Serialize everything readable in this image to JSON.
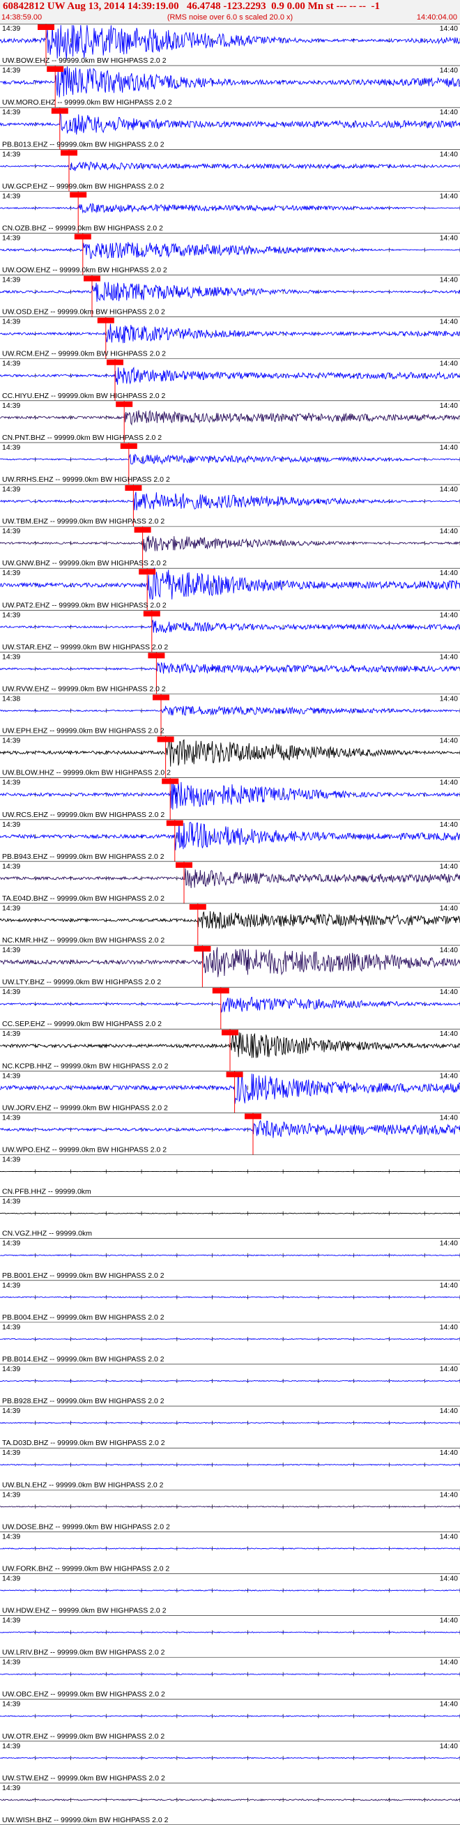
{
  "header": {
    "title": "60842812 UW Aug 13, 2014 14:39:19.00   46.4748 -123.2293  0.9 0.00 Mn st --- -- --  -1",
    "start_time": "14:38:59.00",
    "subtitle": "(RMS noise over 6.0 s scaled 20.0 x)",
    "end_time": "14:40:04.00"
  },
  "colors": {
    "blue": "#0000ff",
    "purple": "#2a0f5e",
    "black": "#000000",
    "pick": "#ff0000"
  },
  "chart_data": {
    "type": "line",
    "title": "60842812 UW Aug 13, 2014 14:39:19.00   46.4748 -123.2293  0.9 0.00 Mn st --- -- --  -1",
    "xlabel": "",
    "ylabel": "",
    "x_start": "14:38:59.00",
    "x_end": "14:40:04.00",
    "series": [
      {
        "name": "UW.BOW.EHZ -- 99999.0km BW  HIGHPASS  2.0  2",
        "tick_left": "14:39",
        "tick_right": "14:40",
        "color": "blue",
        "amp": 1.0,
        "clip": true,
        "pick": 0.1
      },
      {
        "name": "UW.MORO.EHZ -- 99999.0km BW  HIGHPASS  2.0  2",
        "tick_left": "14:39",
        "tick_right": "14:40",
        "color": "blue",
        "amp": 0.8,
        "pick": 0.12
      },
      {
        "name": "PB.B013.EHZ -- 99999.0km BW  HIGHPASS  2.0  2",
        "tick_left": "14:39",
        "tick_right": "14:40",
        "color": "blue",
        "amp": 0.6,
        "pick": 0.13
      },
      {
        "name": "UW.GCP.EHZ -- 99999.0km BW  HIGHPASS  2.0  2",
        "tick_left": "14:39",
        "tick_right": "14:40",
        "color": "blue",
        "amp": 0.3,
        "pick": 0.15
      },
      {
        "name": "CN.OZB.BHZ -- 99999.0km BW  HIGHPASS  2.0  2",
        "tick_left": "14:39",
        "tick_right": "14:40",
        "color": "blue",
        "amp": 0.3,
        "pick": 0.17
      },
      {
        "name": "UW.OOW.EHZ -- 99999.0km BW  HIGHPASS  2.0  2",
        "tick_left": "14:39",
        "tick_right": "14:40",
        "color": "blue",
        "amp": 0.5,
        "clip": true,
        "pick": 0.18
      },
      {
        "name": "UW.OSD.EHZ -- 99999.0km BW  HIGHPASS  2.0  2",
        "tick_left": "14:39",
        "tick_right": "14:40",
        "color": "blue",
        "amp": 0.5,
        "clip": true,
        "pick": 0.2
      },
      {
        "name": "UW.RCM.EHZ -- 99999.0km BW  HIGHPASS  2.0  2",
        "tick_left": "14:39",
        "tick_right": "14:40",
        "color": "blue",
        "amp": 0.5,
        "clip": true,
        "pick": 0.23
      },
      {
        "name": "CC.HIYU.EHZ -- 99999.0km BW  HIGHPASS  2.0  2",
        "tick_left": "14:39",
        "tick_right": "14:40",
        "color": "blue",
        "amp": 0.5,
        "pick": 0.25
      },
      {
        "name": "CN.PNT.BHZ -- 99999.0km BW  HIGHPASS  2.0  2",
        "tick_left": "14:39",
        "tick_right": "14:40",
        "color": "purple",
        "amp": 0.5,
        "pick": 0.27
      },
      {
        "name": "UW.RRHS.EHZ -- 99999.0km BW  HIGHPASS  2.0  2",
        "tick_left": "14:39",
        "tick_right": "14:40",
        "color": "blue",
        "amp": 0.3,
        "pick": 0.28
      },
      {
        "name": "UW.TBM.EHZ -- 99999.0km BW  HIGHPASS  2.0  2",
        "tick_left": "14:39",
        "tick_right": "14:40",
        "color": "blue",
        "amp": 0.5,
        "pick": 0.29
      },
      {
        "name": "UW.GNW.BHZ -- 99999.0km BW  HIGHPASS  2.0  2",
        "tick_left": "14:39",
        "tick_right": "14:40",
        "color": "purple",
        "amp": 0.4,
        "pick": 0.31
      },
      {
        "name": "UW.PAT2.EHZ -- 99999.0km BW  HIGHPASS  2.0  2",
        "tick_left": "14:39",
        "tick_right": "14:40",
        "color": "blue",
        "amp": 0.9,
        "pick": 0.32
      },
      {
        "name": "UW.STAR.EHZ -- 99999.0km BW  HIGHPASS  2.0  2",
        "tick_left": "14:39",
        "tick_right": "14:40",
        "color": "blue",
        "amp": 0.4,
        "pick": 0.33
      },
      {
        "name": "UW.RVW.EHZ -- 99999.0km BW  HIGHPASS  2.0  2",
        "tick_left": "14:39",
        "tick_right": "14:40",
        "color": "blue",
        "amp": 0.4,
        "pick": 0.34
      },
      {
        "name": "UW.EPH.EHZ -- 99999.0km BW  HIGHPASS  2.0  2",
        "tick_left": "14:38",
        "tick_right": "14:40",
        "color": "blue",
        "amp": 0.3,
        "pick": 0.35
      },
      {
        "name": "UW.BLOW.HHZ -- 99999.0km BW  HIGHPASS  2.0  2",
        "tick_left": "14:39",
        "tick_right": "14:40",
        "color": "black",
        "amp": 0.7,
        "pick": 0.36
      },
      {
        "name": "UW.RCS.EHZ -- 99999.0km BW  HIGHPASS  2.0  2",
        "tick_left": "14:39",
        "tick_right": "14:40",
        "color": "blue",
        "amp": 0.7,
        "pick": 0.37
      },
      {
        "name": "PB.B943.EHZ -- 99999.0km BW  HIGHPASS  2.0  2",
        "tick_left": "14:39",
        "tick_right": "14:40",
        "color": "blue",
        "amp": 0.8,
        "pick": 0.38
      },
      {
        "name": "TA.E04D.BHZ -- 99999.0km BW  HIGHPASS  2.0  2",
        "tick_left": "14:39",
        "tick_right": "14:40",
        "color": "purple",
        "amp": 0.6,
        "pick": 0.4
      },
      {
        "name": "NC.KMR.HHZ -- 99999.0km BW  HIGHPASS  2.0  2",
        "tick_left": "14:39",
        "tick_right": "14:40",
        "color": "black",
        "amp": 0.6,
        "pick": 0.43
      },
      {
        "name": "UW.LTY.BHZ -- 99999.0km BW  HIGHPASS  2.0  2",
        "tick_left": "14:39",
        "tick_right": "14:40",
        "color": "purple",
        "amp": 0.9,
        "pick": 0.44
      },
      {
        "name": "CC.SEP.EHZ -- 99999.0km BW  HIGHPASS  2.0  2",
        "tick_left": "14:39",
        "tick_right": "14:40",
        "color": "blue",
        "amp": 0.4,
        "pick": 0.48
      },
      {
        "name": "NC.KCPB.HHZ -- 99999.0km BW  HIGHPASS  2.0  2",
        "tick_left": "14:39",
        "tick_right": "14:40",
        "color": "black",
        "amp": 0.7,
        "pick": 0.5
      },
      {
        "name": "UW.JORV.EHZ -- 99999.0km BW  HIGHPASS  2.0  2",
        "tick_left": "14:39",
        "tick_right": "14:40",
        "color": "blue",
        "amp": 0.9,
        "pick": 0.51
      },
      {
        "name": "UW.WPO.EHZ -- 99999.0km BW  HIGHPASS  2.0  2",
        "tick_left": "14:39",
        "tick_right": "14:40",
        "color": "blue",
        "amp": 0.6,
        "pick": 0.55
      },
      {
        "name": "CN.PFB.HHZ -- 99999.0km",
        "tick_left": "14:39",
        "tick_right": "",
        "color": "black",
        "amp": 0.05
      },
      {
        "name": "CN.VGZ.HHZ -- 99999.0km",
        "tick_left": "14:39",
        "tick_right": "",
        "color": "black",
        "amp": 0.15
      },
      {
        "name": "PB.B001.EHZ -- 99999.0km BW  HIGHPASS  2.0  2",
        "tick_left": "14:39",
        "tick_right": "14:40",
        "color": "blue",
        "amp": 0.2
      },
      {
        "name": "PB.B004.EHZ -- 99999.0km BW  HIGHPASS  2.0  2",
        "tick_left": "14:39",
        "tick_right": "14:40",
        "color": "blue",
        "amp": 0.2
      },
      {
        "name": "PB.B014.EHZ -- 99999.0km BW  HIGHPASS  2.0  2",
        "tick_left": "14:39",
        "tick_right": "14:40",
        "color": "blue",
        "amp": 0.2
      },
      {
        "name": "PB.B928.EHZ -- 99999.0km BW  HIGHPASS  2.0  2",
        "tick_left": "14:39",
        "tick_right": "14:40",
        "color": "blue",
        "amp": 0.2
      },
      {
        "name": "TA.D03D.BHZ -- 99999.0km BW  HIGHPASS  2.0  2",
        "tick_left": "14:39",
        "tick_right": "14:40",
        "color": "blue",
        "amp": 0.2
      },
      {
        "name": "UW.BLN.EHZ -- 99999.0km BW  HIGHPASS  2.0  2",
        "tick_left": "14:39",
        "tick_right": "14:40",
        "color": "blue",
        "amp": 0.2
      },
      {
        "name": "UW.DOSE.BHZ -- 99999.0km BW  HIGHPASS  2.0  2",
        "tick_left": "14:39",
        "tick_right": "14:40",
        "color": "purple",
        "amp": 0.2
      },
      {
        "name": "UW.FORK.BHZ -- 99999.0km BW  HIGHPASS  2.0  2",
        "tick_left": "14:39",
        "tick_right": "14:40",
        "color": "blue",
        "amp": 0.2
      },
      {
        "name": "UW.HDW.EHZ -- 99999.0km BW  HIGHPASS  2.0  2",
        "tick_left": "14:39",
        "tick_right": "14:40",
        "color": "blue",
        "amp": 0.2
      },
      {
        "name": "UW.LRIV.BHZ -- 99999.0km BW  HIGHPASS  2.0  2",
        "tick_left": "14:39",
        "tick_right": "14:40",
        "color": "blue",
        "amp": 0.2
      },
      {
        "name": "UW.OBC.EHZ -- 99999.0km BW  HIGHPASS  2.0  2",
        "tick_left": "14:39",
        "tick_right": "14:40",
        "color": "blue",
        "amp": 0.2
      },
      {
        "name": "UW.OTR.EHZ -- 99999.0km BW  HIGHPASS  2.0  2",
        "tick_left": "14:39",
        "tick_right": "14:40",
        "color": "blue",
        "amp": 0.2
      },
      {
        "name": "UW.STW.EHZ -- 99999.0km BW  HIGHPASS  2.0  2",
        "tick_left": "14:39",
        "tick_right": "14:40",
        "color": "blue",
        "amp": 0.2
      },
      {
        "name": "UW.WISH.BHZ -- 99999.0km BW  HIGHPASS  2.0  2",
        "tick_left": "14:39",
        "tick_right": "",
        "color": "purple",
        "amp": 0.3
      }
    ]
  }
}
